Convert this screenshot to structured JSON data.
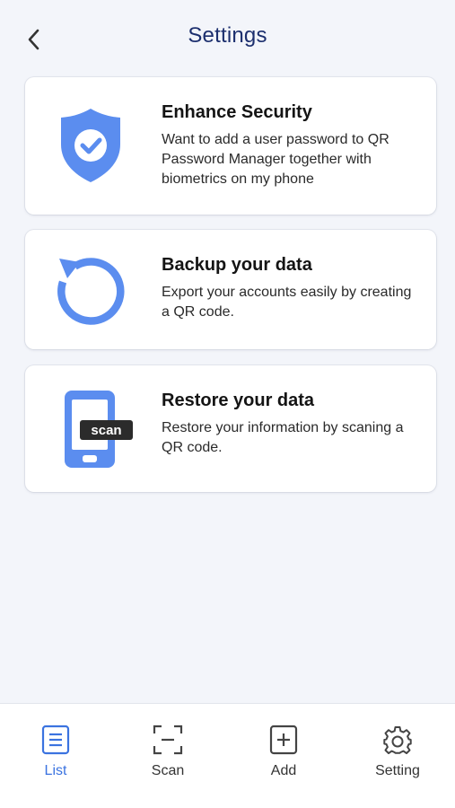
{
  "header": {
    "title": "Settings",
    "back_icon": "chevron-left-icon"
  },
  "cards": [
    {
      "icon": "shield-check-icon",
      "title": "Enhance Security",
      "description": "Want to add a user password to QR Password Manager together with biometrics on my phone"
    },
    {
      "icon": "backup-rotate-icon",
      "title": "Backup your data",
      "description": "Export your accounts easily by creating a QR code."
    },
    {
      "icon": "phone-scan-icon",
      "icon_badge": "scan",
      "title": "Restore your data",
      "description": "Restore your information by scaning a QR code."
    }
  ],
  "tabbar": {
    "tabs": [
      {
        "label": "List",
        "icon": "list-icon",
        "active": true
      },
      {
        "label": "Scan",
        "icon": "scan-icon",
        "active": false
      },
      {
        "label": "Add",
        "icon": "add-icon",
        "active": false
      },
      {
        "label": "Setting",
        "icon": "gear-icon",
        "active": false
      }
    ]
  },
  "colors": {
    "accent": "#3b73e0",
    "icon_blue": "#5b8def",
    "title_navy": "#1c2f6e",
    "background": "#f3f5fa",
    "badge_dark": "#2b2b2b"
  }
}
